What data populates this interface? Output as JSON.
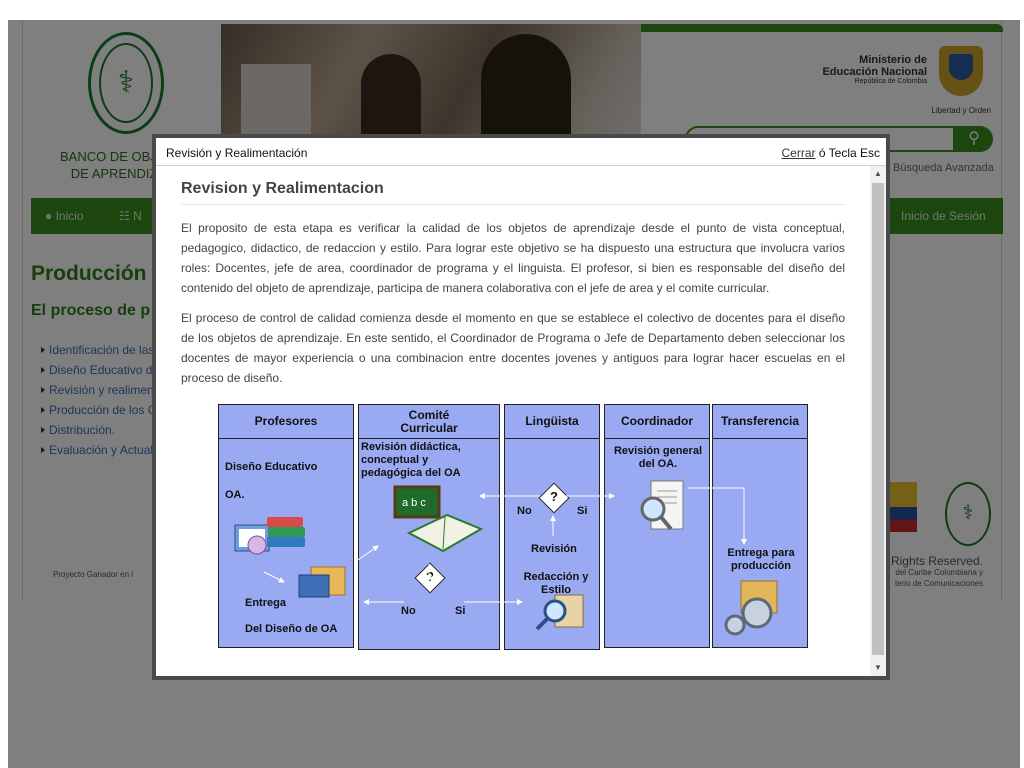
{
  "background": {
    "bank_title_line1": "BANCO DE OBJETOS",
    "bank_title_line2": "DE APRENDIZAJE",
    "ministry_line1": "Ministerio de",
    "ministry_line2": "Educación Nacional",
    "ministry_line3": "República de Colombia",
    "libertad": "Libertad y Orden",
    "advanced_search": "Búsqueda Avanzada",
    "nav": {
      "home": "Inicio",
      "second": "N",
      "login": "Inicio de Sesión"
    },
    "heading_produccion": "Producción",
    "heading_proceso": "El proceso de p",
    "side_links": [
      "Identificación de las",
      "Diseño Educativo d",
      "Revisión y realimen",
      "Producción de los C",
      "Distribución.",
      "Evaluación y Actual"
    ],
    "footer_left": "Proyecto Ganador en l",
    "rights": "All Rights Reserved.",
    "footer_line2": "del Caribe Colombiana y",
    "footer_line3": "terio de Comunicaciones"
  },
  "modal": {
    "header_title": "Revisión y Realimentación",
    "close_link": "Cerrar",
    "close_rest": " ó Tecla Esc",
    "content_title": "Revision y Realimentacion",
    "paragraph1": "El proposito de esta etapa  es verificar la calidad de los objetos de aprendizaje desde el punto de vista conceptual, pedagogico, didactico, de redaccion y estilo. Para lograr este objetivo se ha dispuesto  una estructura que involucra varios roles: Docentes, jefe de area, coordinador de programa  y el linguista. El  profesor, si bien es responsable del diseño del contenido del objeto de aprendizaje, participa de manera colaborativa con el jefe de area y el comite curricular.",
    "paragraph2": "El proceso de control de calidad comienza desde el momento en que se establece el colectivo de docentes para el diseño de los objetos de aprendizaje. En este sentido, el Coordinador de Programa o Jefe de Departamento deben seleccionar los docentes de mayor experiencia o una combinacion entre docentes jovenes y antiguos para lograr hacer escuelas en el proceso de diseño."
  },
  "diagram": {
    "columns": [
      "Profesores",
      "Comité Curricular",
      "Lingüista",
      "Coordinador",
      "Transferencia"
    ],
    "profesores_text1": "Diseño Educativo",
    "profesores_text2": "OA.",
    "profesores_text3": "Entrega",
    "profesores_text4": "Del Diseño de  OA",
    "comite_text": "Revisión didáctica, conceptual y pedagógica del OA",
    "question": "?",
    "no": "No",
    "si": "Si",
    "linguista_text1": "Revisión",
    "linguista_text2": "Redacción y Estilo",
    "coordinador_text": "Revisión general del OA.",
    "transferencia_text": "Entrega para producción",
    "board_text": "a b c"
  },
  "colors": {
    "brand_green": "#3a8d1f",
    "diagram_blue": "#99aaf2",
    "overlay": "rgba(0,0,0,0.5)"
  }
}
